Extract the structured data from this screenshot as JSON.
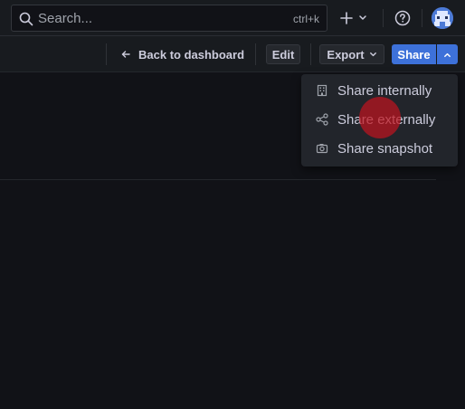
{
  "topbar": {
    "search_placeholder": "Search...",
    "search_shortcut": "ctrl+k"
  },
  "toolbar": {
    "back_label": "Back to dashboard",
    "edit_label": "Edit",
    "export_label": "Export",
    "share_label": "Share"
  },
  "share_menu": {
    "items": [
      {
        "label": "Share internally",
        "icon": "building-icon"
      },
      {
        "label": "Share externally",
        "icon": "share-nodes-icon"
      },
      {
        "label": "Share snapshot",
        "icon": "camera-icon"
      }
    ]
  },
  "colors": {
    "background": "#111217",
    "bar": "#181b1f",
    "primary": "#3d71d9",
    "menu": "#22252b",
    "cursor": "#be141e"
  }
}
